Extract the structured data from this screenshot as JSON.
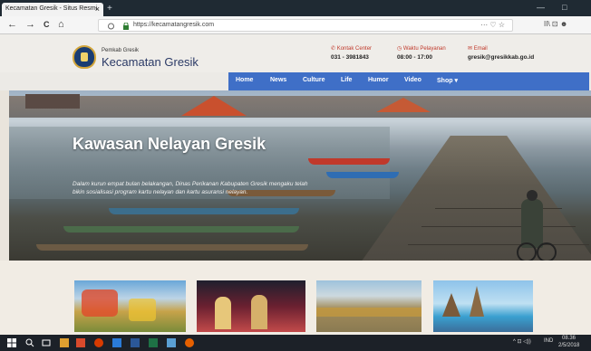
{
  "browser": {
    "tab_title": "Kecamatan Gresik - Situs Resmi",
    "close_glyph": "×",
    "newtab_glyph": "+",
    "window_controls": [
      "—",
      "□"
    ],
    "back_glyph": "←",
    "forward_glyph": "→",
    "reload_glyph": "C",
    "home_glyph": "⌂",
    "url": "https://kecamatangresik.com",
    "url_icons": "··· ♡ ☆",
    "right_icons": "II\\ ⊡ ☻"
  },
  "header": {
    "pemkab": "Pemkab Gresik",
    "site_name": "Kecamatan Gresik",
    "contacts": [
      {
        "label": "Kontak Center",
        "value": "031 - 3981843",
        "icon": "phone-icon"
      },
      {
        "label": "Waktu Pelayanan",
        "value": "08:00 - 17:00",
        "icon": "clock-icon"
      },
      {
        "label": "Email",
        "value": "gresik@gresikkab.go.id",
        "icon": "mail-icon"
      }
    ]
  },
  "nav": {
    "items": [
      "Home",
      "News",
      "Culture",
      "Life",
      "Humor",
      "Video",
      "Shop ▾"
    ],
    "accent": "#3f6fc7"
  },
  "hero": {
    "title": "Kawasan Nelayan Gresik",
    "description": "Dalam kurun empat bulan belakangan, Dinas Perikanan Kabupaten Gresik mengaku telah bikin sosialisasi program kartu nelayan dan kartu asuransi nelayan."
  },
  "taskbar": {
    "lang": "IND",
    "time": "08.36",
    "date": "2/5/2018",
    "tray_glyphs": "^ ⊡ ◁))"
  }
}
